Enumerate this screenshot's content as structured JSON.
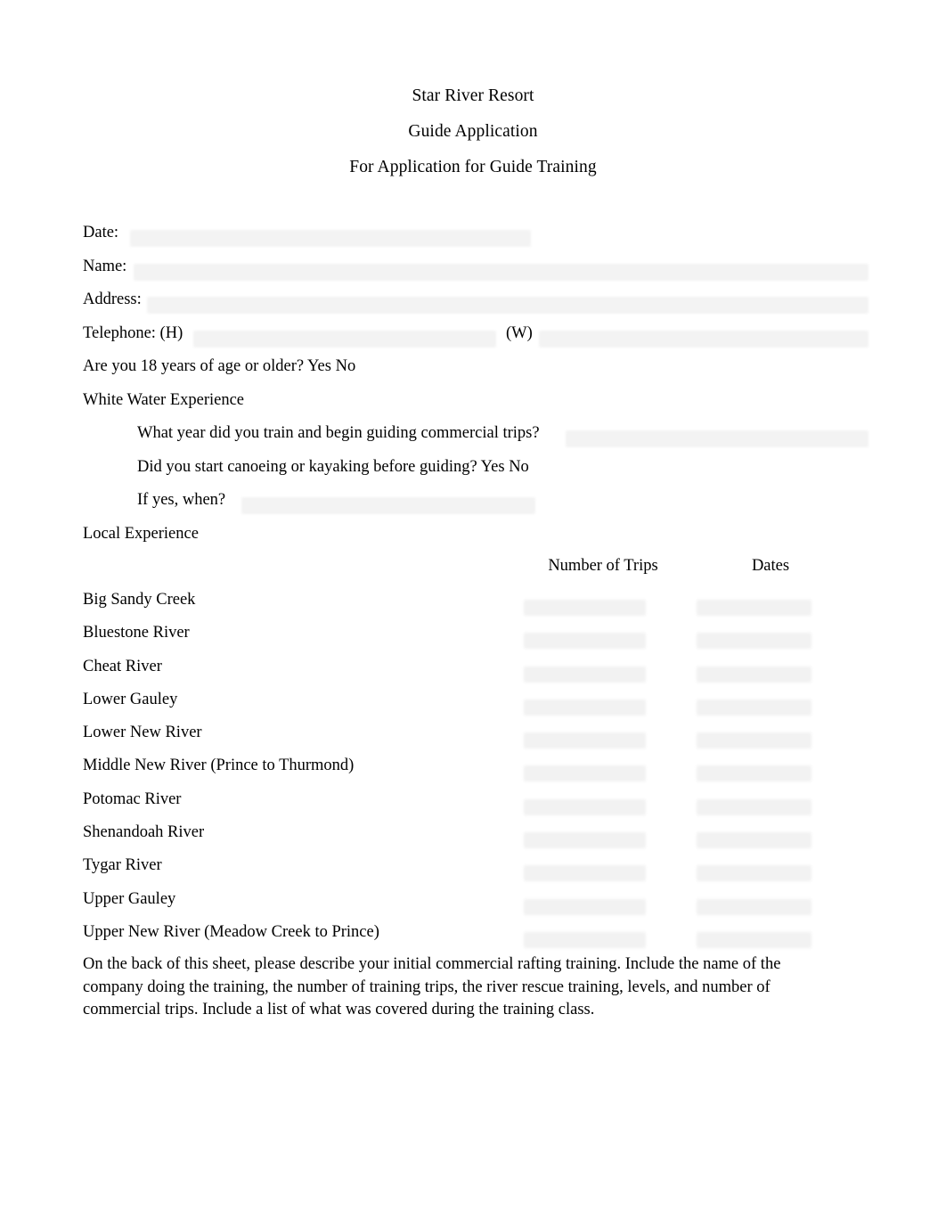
{
  "document": {
    "titles": [
      "Star River Resort",
      "Guide Application",
      "For Application for Guide Training"
    ]
  },
  "form": {
    "date_label": "Date:",
    "name_label": "Name:",
    "address_label": "Address:",
    "telephone_label": "Telephone: (H)",
    "telephone_work_label": "(W)",
    "age_question": "Are you 18 years of age or older? Yes   No",
    "whitewater_heading": "White Water Experience",
    "whitewater_q1": "What year did you train and begin guiding commercial trips?",
    "whitewater_q2": "Did you start canoeing or kayaking before guiding? Yes   No",
    "whitewater_q3": "If yes, when?",
    "local_heading": "Local Experience"
  },
  "table": {
    "headers": {
      "trips": "Number of Trips",
      "dates": "Dates"
    },
    "rivers": [
      "Big Sandy Creek",
      "Bluestone River",
      "Cheat River",
      "Lower Gauley",
      "Lower New River",
      "Middle New River (Prince to Thurmond)",
      "Potomac River",
      "Shenandoah River",
      "Tygar River",
      "Upper Gauley",
      "Upper New River (Meadow Creek to Prince)"
    ]
  },
  "closing": {
    "paragraph": "On the back of this sheet, please describe your initial commercial rafting training. Include the name of the company doing the training, the number of training trips, the river rescue training, levels, and number of commercial trips. Include a list of what was covered during the training class."
  }
}
